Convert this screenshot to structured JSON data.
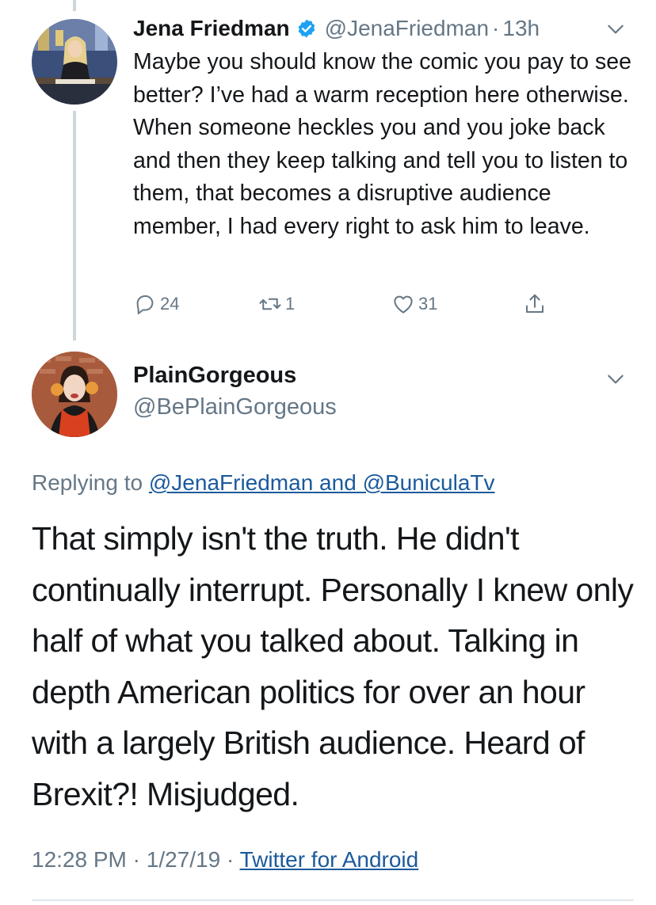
{
  "tweet1": {
    "name": "Jena Friedman",
    "handle": "@JenaFriedman",
    "separator": "·",
    "time": "13h",
    "text": "Maybe you should know the comic you pay to see better? I’ve had a warm reception here otherwise. When someone heckles you and you joke back and then they keep talking and tell you to listen to them, that becomes a disruptive audience member, I had every right to ask him to leave.",
    "actions": {
      "reply_count": "24",
      "retweet_count": "1",
      "like_count": "31"
    },
    "icons": [
      "verified-badge-icon",
      "chevron-down-icon",
      "reply-icon",
      "retweet-icon",
      "like-icon",
      "share-icon"
    ]
  },
  "tweet2": {
    "name": "PlainGorgeous",
    "handle": "@BePlainGorgeous",
    "replying_prefix": "Replying to ",
    "replying_user1": "@JenaFriedman",
    "replying_and": " and ",
    "replying_user2": "@BuniculaTv",
    "text": "That simply isn't the truth. He didn't continually interrupt. Personally I knew only half of what you talked about. Talking in depth American politics for over an hour with a largely British audience. Heard of Brexit?! Misjudged.",
    "time": "12:28 PM",
    "separator1": " · ",
    "date": "1/27/19",
    "separator2": " · ",
    "source": "Twitter for Android"
  },
  "colors": {
    "text": "#14171a",
    "secondary": "#657786",
    "link": "#1b5a9c",
    "verified": "#1da1f2",
    "thread_line": "#ccd6dd"
  }
}
